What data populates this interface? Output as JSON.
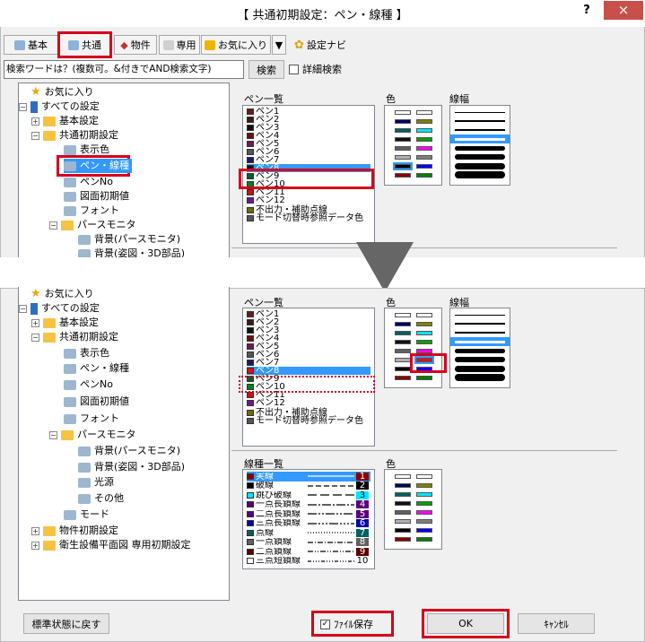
{
  "window": {
    "title": "【 共通初期設定：ペン・線種 】",
    "help": "?",
    "close": "×"
  },
  "toolbar": {
    "kihon": "基本",
    "kyotsu": "共通",
    "bukken": "物件",
    "senyo": "専用",
    "okiniiri": "お気に入り",
    "dropdown": "▼",
    "navi": "設定ナビ"
  },
  "search": {
    "value": "検索ワードは？(複数可。&付きでAND検索文字)",
    "button": "検索",
    "detail": "詳細検索"
  },
  "tree_top": [
    {
      "label": "お気に入り"
    },
    {
      "label": "すべての設定"
    },
    {
      "label": "基本設定"
    },
    {
      "label": "共通初期設定"
    },
    {
      "label": "表示色"
    },
    {
      "label": "ペン・線種"
    },
    {
      "label": "ペンNo"
    },
    {
      "label": "図面初期値"
    },
    {
      "label": "フォント"
    },
    {
      "label": "パースモニタ"
    },
    {
      "label": "背景(パースモニタ)"
    },
    {
      "label": "背景(姿図・3D部品)"
    }
  ],
  "tree_bottom": [
    {
      "label": "お気に入り"
    },
    {
      "label": "すべての設定"
    },
    {
      "label": "基本設定"
    },
    {
      "label": "共通初期設定"
    },
    {
      "label": "表示色"
    },
    {
      "label": "ペン・線種"
    },
    {
      "label": "ペンNo"
    },
    {
      "label": "図面初期値"
    },
    {
      "label": "フォント"
    },
    {
      "label": "パースモニタ"
    },
    {
      "label": "背景(パースモニタ)"
    },
    {
      "label": "背景(姿図・3D部品)"
    },
    {
      "label": "光源"
    },
    {
      "label": "その他"
    },
    {
      "label": "モード"
    },
    {
      "label": "物件初期設定"
    },
    {
      "label": "衛生設備平面図 専用初期設定"
    }
  ],
  "pens": {
    "header": "ペン一覧",
    "color_header": "色",
    "width_header": "線幅",
    "items": [
      "ペン1",
      "ペン2",
      "ペン3",
      "ペン4",
      "ペン5",
      "ペン6",
      "ペン7",
      "ペン8",
      "ペン9",
      "ペン10",
      "ペン11",
      "ペン12",
      "不出力・補助点線",
      "モード切替時参照データ色"
    ],
    "colors": [
      "#6b1a1a",
      "#3a1a1a",
      "#111111",
      "#6b1010",
      "#6b1a5a",
      "#555555",
      "#1a1a6b",
      "#111111",
      "#0a5a2a",
      "#0d7a2a",
      "#cc1111",
      "#6a1a8a",
      "#6b6b10",
      "#555555"
    ]
  },
  "line_types": {
    "header": "線種一覧",
    "color_header": "色",
    "items": [
      "実線",
      "破線",
      "跳び破線",
      "一点長鎖線",
      "二点長鎖線",
      "三点長鎖線",
      "点線",
      "一点鎖線",
      "二点鎖線",
      "三点短鎖線"
    ],
    "numbers": [
      "1",
      "2",
      "3",
      "4",
      "5",
      "6",
      "7",
      "8",
      "9",
      "10"
    ]
  },
  "buttons": {
    "reset": "標準状態に戻す",
    "save_file": "ﾌｧｲﾙ保存",
    "ok": "OK",
    "cancel": "ｷｬﾝｾﾙ"
  }
}
